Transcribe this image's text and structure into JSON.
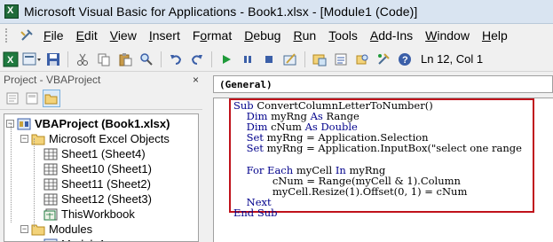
{
  "window": {
    "title": "Microsoft Visual Basic for Applications - Book1.xlsx - [Module1 (Code)]",
    "app_icon": "excel-vba-icon"
  },
  "menu": {
    "items": [
      {
        "label": "File",
        "mnemonic": "F"
      },
      {
        "label": "Edit",
        "mnemonic": "E"
      },
      {
        "label": "View",
        "mnemonic": "V"
      },
      {
        "label": "Insert",
        "mnemonic": "I"
      },
      {
        "label": "Format",
        "mnemonic": "o"
      },
      {
        "label": "Debug",
        "mnemonic": "D"
      },
      {
        "label": "Run",
        "mnemonic": "R"
      },
      {
        "label": "Tools",
        "mnemonic": "T"
      },
      {
        "label": "Add-Ins",
        "mnemonic": "A"
      },
      {
        "label": "Window",
        "mnemonic": "W"
      },
      {
        "label": "Help",
        "mnemonic": "H"
      }
    ]
  },
  "toolbar": {
    "status": "Ln 12, Col 1",
    "icons": [
      "view-excel-icon",
      "insert-module-icon",
      "save-icon",
      "cut-icon",
      "copy-icon",
      "paste-icon",
      "find-icon",
      "undo-icon",
      "redo-icon",
      "run-icon",
      "break-icon",
      "reset-icon",
      "design-mode-icon",
      "project-explorer-icon",
      "properties-icon",
      "object-browser-icon",
      "toolbox-icon",
      "help-icon"
    ]
  },
  "project_pane": {
    "title": "Project - VBAProject",
    "close_glyph": "×",
    "tree": [
      {
        "level": 0,
        "label": "VBAProject (Book1.xlsx)",
        "bold": true,
        "expander": "−",
        "icon": "vba-project-icon"
      },
      {
        "level": 1,
        "label": "Microsoft Excel Objects",
        "expander": "−",
        "icon": "folder-icon"
      },
      {
        "level": 2,
        "label": "Sheet1 (Sheet4)",
        "icon": "sheet-icon"
      },
      {
        "level": 2,
        "label": "Sheet10 (Sheet1)",
        "icon": "sheet-icon"
      },
      {
        "level": 2,
        "label": "Sheet11 (Sheet2)",
        "icon": "sheet-icon"
      },
      {
        "level": 2,
        "label": "Sheet12 (Sheet3)",
        "icon": "sheet-icon"
      },
      {
        "level": 2,
        "label": "ThisWorkbook",
        "icon": "workbook-icon"
      },
      {
        "level": 1,
        "label": "Modules",
        "expander": "−",
        "icon": "folder-icon"
      },
      {
        "level": 2,
        "label": "Module1",
        "icon": "module-icon"
      }
    ]
  },
  "code_window": {
    "object_combo": "(General)",
    "lines": [
      [
        {
          "t": "Sub ",
          "k": true
        },
        {
          "t": "ConvertColumnLetterToNumber()"
        }
      ],
      [
        {
          "t": "    "
        },
        {
          "t": "Dim ",
          "k": true
        },
        {
          "t": "myRng "
        },
        {
          "t": "As ",
          "k": true
        },
        {
          "t": "Range"
        }
      ],
      [
        {
          "t": "    "
        },
        {
          "t": "Dim ",
          "k": true
        },
        {
          "t": "cNum "
        },
        {
          "t": "As ",
          "k": true
        },
        {
          "t": "Double",
          "k": true
        }
      ],
      [
        {
          "t": "    "
        },
        {
          "t": "Set ",
          "k": true
        },
        {
          "t": "myRng = Application.Selection"
        }
      ],
      [
        {
          "t": "    "
        },
        {
          "t": "Set ",
          "k": true
        },
        {
          "t": "myRng = Application.InputBox(\"select one range"
        }
      ],
      [
        {
          "t": ""
        }
      ],
      [
        {
          "t": "    "
        },
        {
          "t": "For Each ",
          "k": true
        },
        {
          "t": "myCell "
        },
        {
          "t": "In ",
          "k": true
        },
        {
          "t": "myRng"
        }
      ],
      [
        {
          "t": "            cNum = Range(myCell & 1).Column"
        }
      ],
      [
        {
          "t": "            myCell.Resize(1).Offset(0, 1) = cNum"
        }
      ],
      [
        {
          "t": "    "
        },
        {
          "t": "Next",
          "k": true
        }
      ],
      [
        {
          "t": "End Sub",
          "k": true
        }
      ]
    ]
  },
  "colors": {
    "keyword": "#00008b",
    "highlight_border": "#c0121b",
    "titlebar_bg": "#d9e4f1"
  }
}
